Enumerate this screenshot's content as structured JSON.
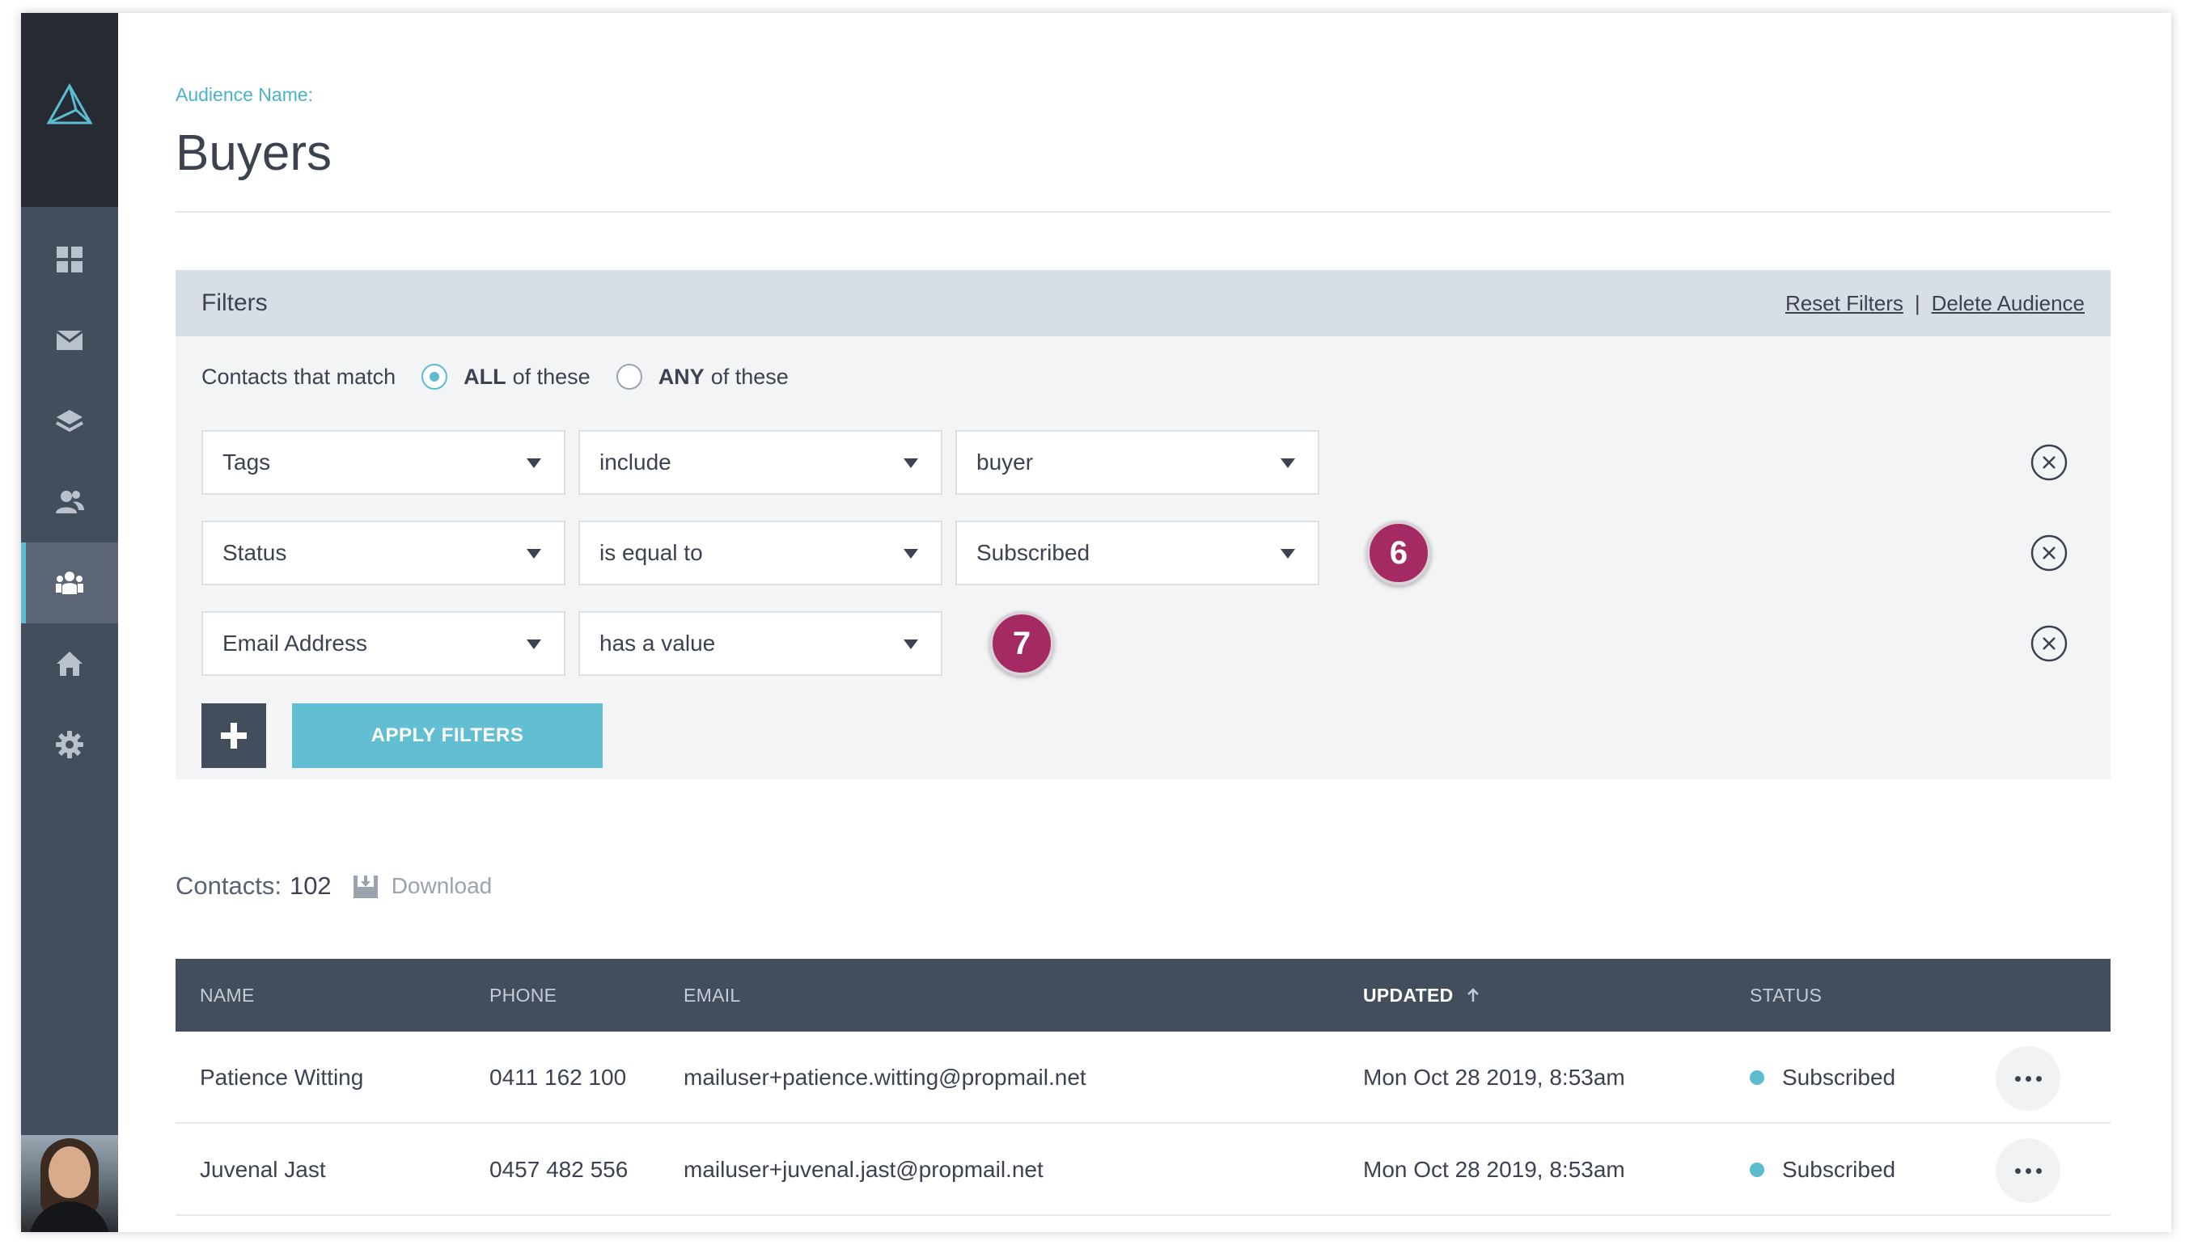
{
  "header": {
    "audience_label": "Audience Name:",
    "title": "Buyers"
  },
  "filters": {
    "title": "Filters",
    "reset_label": "Reset Filters",
    "delete_label": "Delete Audience",
    "separator": "|",
    "match_label": "Contacts that match",
    "match_all_bold": "ALL",
    "match_all_rest": "of these",
    "match_any_bold": "ANY",
    "match_any_rest": "of these",
    "match_selected": "ALL",
    "rows": [
      {
        "field": "Tags",
        "operator": "include",
        "value": "buyer"
      },
      {
        "field": "Status",
        "operator": "is equal to",
        "value": "Subscribed"
      },
      {
        "field": "Email Address",
        "operator": "has a value"
      }
    ],
    "apply_label": "APPLY FILTERS"
  },
  "badges": [
    "6",
    "7"
  ],
  "contacts": {
    "label": "Contacts:",
    "count": "102",
    "download_label": "Download"
  },
  "table": {
    "columns": [
      "NAME",
      "PHONE",
      "EMAIL",
      "UPDATED",
      "STATUS"
    ],
    "sorted_column": "UPDATED",
    "rows": [
      {
        "name": "Patience Witting",
        "phone": "0411 162 100",
        "email": "mailuser+patience.witting@propmail.net",
        "updated": "Mon Oct 28 2019, 8:53am",
        "status": "Subscribed"
      },
      {
        "name": "Juvenal Jast",
        "phone": "0457 482 556",
        "email": "mailuser+juvenal.jast@propmail.net",
        "updated": "Mon Oct 28 2019, 8:53am",
        "status": "Subscribed"
      }
    ]
  },
  "colors": {
    "accent": "#5bbcd0",
    "sidebar": "#434e5d",
    "sidebar_top": "#262b33",
    "badge": "#a42a64",
    "filters_header": "#d8dee6"
  },
  "icons": {
    "logo": "triangle-logo-icon",
    "nav": [
      "dashboard-icon",
      "mail-icon",
      "layers-icon",
      "contacts-icon",
      "audiences-icon",
      "home-icon",
      "settings-icon"
    ],
    "remove": "close-circle-icon",
    "add": "plus-icon",
    "download": "download-icon",
    "sort": "arrow-up-icon",
    "more": "more-dots-icon"
  }
}
